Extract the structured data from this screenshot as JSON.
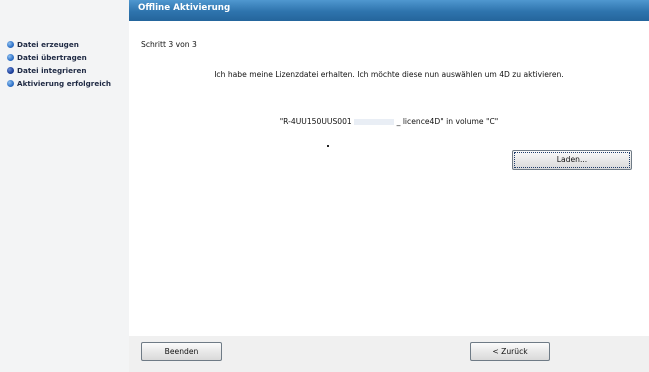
{
  "window": {
    "title": "Offline Aktivierung"
  },
  "sidebar": {
    "steps": [
      {
        "label": "Datei erzeugen"
      },
      {
        "label": "Datei übertragen"
      },
      {
        "label": "Datei integrieren"
      },
      {
        "label": "Aktivierung erfolgreich"
      }
    ]
  },
  "content": {
    "step_counter": "Schritt 3 von 3",
    "message": "Ich habe meine Lizenzdatei erhalten. Ich möchte diese nun auswählen um 4D zu aktivieren.",
    "file_prefix": "\"R-4UU150UUS001",
    "file_suffix": "_ licence4D\" in volume \"C\"",
    "load_button": "Laden..."
  },
  "footer": {
    "quit_button": "Beenden",
    "back_button": "< Zurück"
  },
  "colors": {
    "titlebar": "#2e74ad",
    "sidebar_bg": "#f3f4f5",
    "step_dot": "#2f72c8"
  }
}
